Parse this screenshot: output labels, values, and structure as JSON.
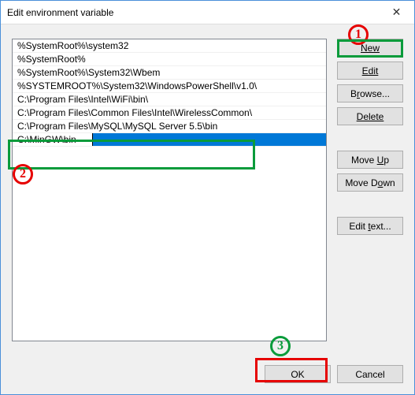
{
  "window": {
    "title": "Edit environment variable",
    "close_glyph": "✕"
  },
  "list": {
    "items": [
      "%SystemRoot%\\system32",
      "%SystemRoot%",
      "%SystemRoot%\\System32\\Wbem",
      "%SYSTEMROOT%\\System32\\WindowsPowerShell\\v1.0\\",
      "C:\\Program Files\\Intel\\WiFi\\bin\\",
      "C:\\Program Files\\Common Files\\Intel\\WirelessCommon\\",
      "C:\\Program Files\\MySQL\\MySQL Server 5.5\\bin"
    ],
    "editing_value": "C:\\MinGW\\bin"
  },
  "buttons": {
    "new": "New",
    "edit": "Edit",
    "browse": "Browse...",
    "delete": "Delete",
    "moveup": "Move Up",
    "movedown": "Move Down",
    "edittext": "Edit text...",
    "ok": "OK",
    "cancel": "Cancel"
  },
  "annotations": {
    "n1": "1",
    "n2": "2",
    "n3": "3"
  }
}
